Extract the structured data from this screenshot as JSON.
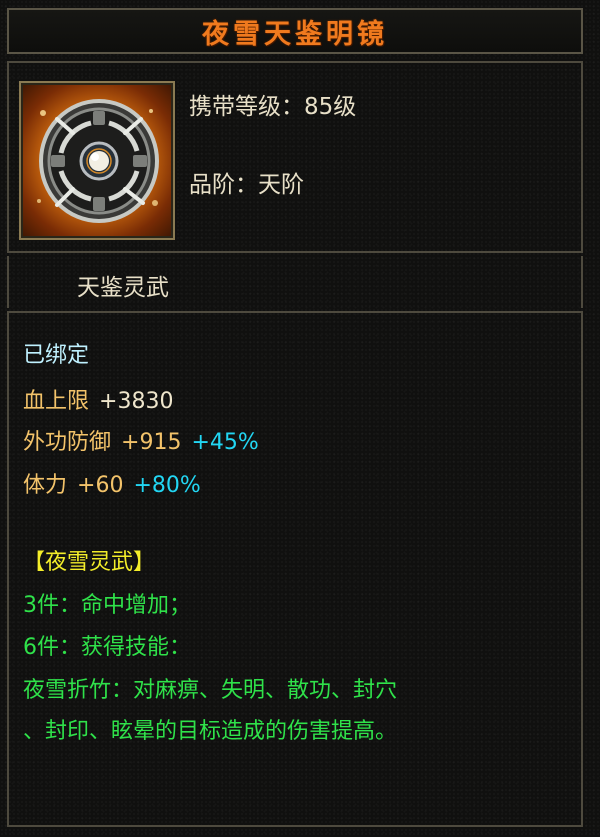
{
  "title": "夜雪天鉴明镜",
  "item_icon": "mirror-icon",
  "info": {
    "level_label": "携带等级：",
    "level_value": "85级",
    "grade_label": "品阶：",
    "grade_value": "天阶"
  },
  "subtitle": "天鉴灵武",
  "bound": "已绑定",
  "stats": [
    {
      "name": "血上限",
      "value": "+3830",
      "bonus": ""
    },
    {
      "name": "外功防御",
      "value": "+915",
      "bonus": "+45%"
    },
    {
      "name": "体力",
      "value": "+60",
      "bonus": "+80%"
    }
  ],
  "set": {
    "name": "【夜雪灵武】",
    "effects": [
      "3件：命中增加；",
      "6件：获得技能：",
      "夜雪折竹：对麻痹、失明、散功、封穴",
      "、封印、眩晕的目标造成的伤害提高。"
    ]
  },
  "colors": {
    "title": "#f07a1e",
    "bound": "#bff1ff",
    "stat_name": "#f3c36a",
    "stat_bonus": "#22d6f3",
    "set_name": "#f4ee2a",
    "set_effect": "#2fe24a"
  }
}
